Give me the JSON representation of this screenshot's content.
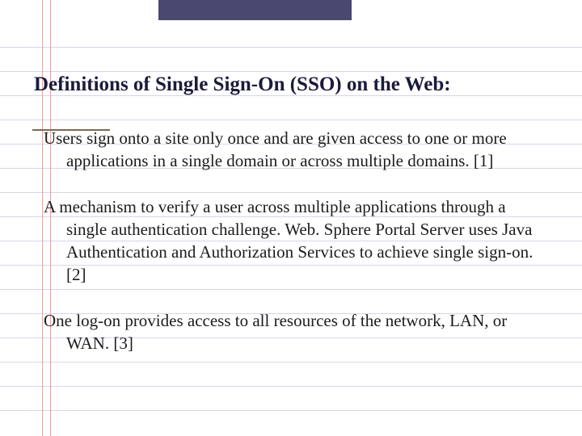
{
  "slide": {
    "title": "Definitions of Single Sign-On (SSO) on the Web:",
    "definitions": [
      {
        "text": "Users sign onto a site only once and are given access to one or more applications in a single domain or across multiple domains. ",
        "ref": "[1]"
      },
      {
        "text": "A mechanism to verify a user across multiple applications through a single authentication challenge. Web. Sphere Portal Server uses Java Authentication and Authorization Services to achieve single sign-on.",
        "ref": "[2]"
      },
      {
        "text": "One log-on provides access to all resources of the network, LAN, or WAN. ",
        "ref": "[3]"
      }
    ]
  }
}
